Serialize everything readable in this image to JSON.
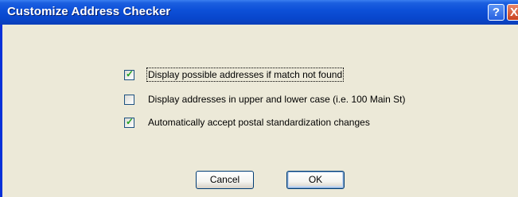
{
  "window": {
    "title": "Customize Address Checker",
    "help_glyph": "?",
    "close_glyph": "X"
  },
  "options": [
    {
      "label": "Display possible addresses if match not found",
      "checked": true,
      "focused": true
    },
    {
      "label": "Display addresses in upper and lower case (i.e. 100 Main St)",
      "checked": false,
      "focused": false
    },
    {
      "label": "Automatically accept postal standardization changes",
      "checked": true,
      "focused": false
    }
  ],
  "buttons": {
    "cancel_label": "Cancel",
    "ok_label": "OK"
  },
  "colors": {
    "titlebar": "#0846cc",
    "dialog_face": "#ece9d8",
    "checkmark": "#21a121"
  },
  "icons": {
    "help": "help-icon",
    "close": "close-icon",
    "check": "checkmark-icon"
  }
}
